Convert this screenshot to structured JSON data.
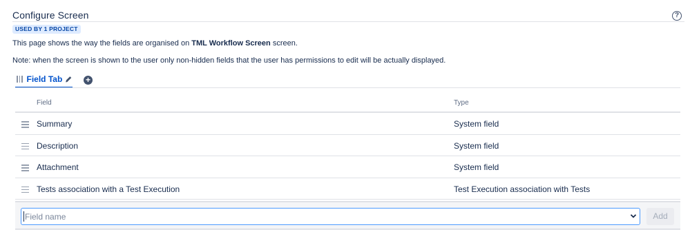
{
  "header": {
    "title": "Configure Screen",
    "help_icon": "question-circle-icon",
    "badge": "USED BY 1 PROJECT"
  },
  "description": {
    "prefix": "This page shows the way the fields are organised on ",
    "screen_name": "TML Workflow Screen",
    "suffix": " screen."
  },
  "note": "Note: when the screen is shown to the user only non-hidden fields that the user has permissions to edit will be actually displayed.",
  "tabs": [
    {
      "label": "Field Tab",
      "icons": [
        "drag-handle-icon",
        "pencil-icon"
      ],
      "active": true
    }
  ],
  "add_tab_icon": "plus-circle-icon",
  "table": {
    "columns": [
      "Field",
      "Type"
    ],
    "rows": [
      {
        "field": "Summary",
        "type": "System field"
      },
      {
        "field": "Description",
        "type": "System field"
      },
      {
        "field": "Attachment",
        "type": "System field"
      },
      {
        "field": "Tests association with a Test Execution",
        "type": "Test Execution association with Tests"
      }
    ]
  },
  "add_field": {
    "placeholder": "Field name",
    "button_label": "Add"
  },
  "colors": {
    "accent": "#0052cc",
    "badge_bg": "#deebff",
    "badge_text": "#0747a6",
    "focus_border": "#4c9aff"
  }
}
